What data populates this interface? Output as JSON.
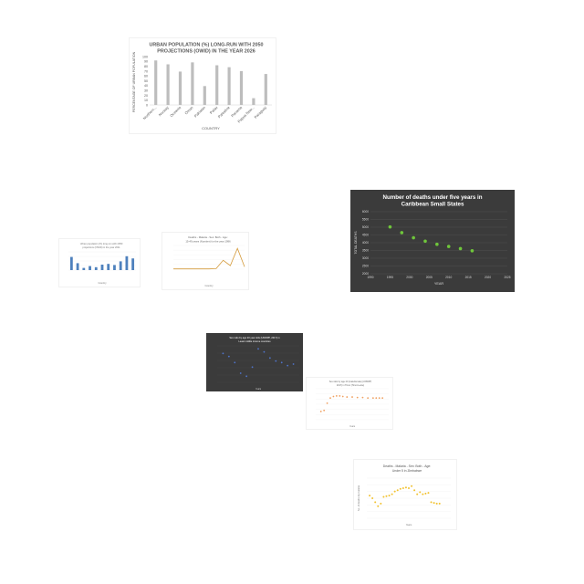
{
  "chart_data": [
    {
      "type": "bar",
      "title": "URBAN POPULATION (%) LONG-RUN WITH 2050 PROJECTIONS (OWID) IN THE YEAR 2026",
      "xlabel": "COUNTRY",
      "ylabel": "PERCENTAGE OF URBAN POPULATION",
      "ylim": [
        0,
        100
      ],
      "yticks": [
        0,
        10,
        20,
        30,
        40,
        50,
        60,
        70,
        80,
        90,
        100
      ],
      "categories": [
        "Northern...",
        "Norway",
        "Oceania",
        "Oman",
        "Pakistan",
        "Palau",
        "Palestine",
        "Panama",
        "Papua New...",
        "Paraguay"
      ],
      "values": [
        92,
        84,
        69,
        88,
        39,
        82,
        78,
        70,
        14,
        64
      ],
      "colors": {
        "bar": "#bdbdbd",
        "text": "#595959"
      }
    },
    {
      "type": "bar",
      "title": "Urban population (%) long-run with 2050 projections (OWID) in the year 2011",
      "xlabel": "Country",
      "ylabel": "",
      "ylim": [
        0,
        100
      ],
      "categories": [
        "",
        "",
        "",
        "",
        "",
        "",
        "",
        "",
        "",
        "",
        ""
      ],
      "values": [
        72,
        38,
        12,
        22,
        16,
        30,
        34,
        28,
        48,
        76,
        64
      ],
      "colors": {
        "bar": "#4e81bd"
      }
    },
    {
      "type": "line",
      "title": "Deaths - Malaria - Sex: Both - Age: 15-49 years (Number) for the year 1996",
      "xlabel": "Country",
      "ylabel": "",
      "categories": [
        "",
        "",
        "",
        "",
        "",
        "",
        "",
        "",
        "",
        "",
        ""
      ],
      "values": [
        1,
        1,
        1,
        1,
        1,
        1,
        2,
        30,
        12,
        70,
        8
      ],
      "colors": {
        "line": "#d49a3a"
      }
    },
    {
      "type": "scatter",
      "title": "Number of deaths under five years in Caribbean Small States",
      "xlabel": "YEAR",
      "ylabel": "TOTAL DEATHS",
      "xlim": [
        1990,
        2025
      ],
      "xticks": [
        1990,
        1995,
        2000,
        2005,
        2010,
        2015,
        2020,
        2025
      ],
      "ylim": [
        2000,
        6000
      ],
      "yticks": [
        2000,
        2500,
        3000,
        3500,
        4000,
        4500,
        5000,
        5500,
        6000
      ],
      "x": [
        1995,
        1998,
        2001,
        2004,
        2007,
        2010,
        2013,
        2016
      ],
      "y": [
        5020,
        4650,
        4320,
        4100,
        3900,
        3760,
        3620,
        3480
      ],
      "colors": {
        "point": "#6fc63b",
        "background": "#3b3b3b",
        "grid": "#555555",
        "text": "#d9d9d9"
      }
    },
    {
      "type": "scatter",
      "title": "Sex ratio by age 20 year olds (UNWPP, 2017) in Least middle income countries",
      "xlabel": "Years",
      "ylabel": "",
      "xlim": [
        1950,
        2020
      ],
      "ylim": [
        92,
        104
      ],
      "x": [
        1955,
        1960,
        1965,
        1970,
        1975,
        1980,
        1985,
        1990,
        1995,
        2000,
        2005,
        2010,
        2015
      ],
      "y": [
        101.5,
        100.5,
        98.5,
        95,
        94,
        97,
        103,
        102,
        100,
        99,
        98.5,
        97.5,
        98
      ],
      "colors": {
        "point": "#4f73c8",
        "background": "#3b3b3b",
        "text": "#d9d9d9"
      }
    },
    {
      "type": "scatter",
      "title": "Sex ratio by age 20 (male/female) (UNWPP, 2017) in Timor (Timor-Leste)",
      "xlabel": "Years",
      "ylabel": "",
      "xlim": [
        1950,
        2020
      ],
      "ylim": [
        80,
        110
      ],
      "x": [
        1955,
        1958,
        1961,
        1964,
        1967,
        1970,
        1973,
        1976,
        1980,
        1985,
        1990,
        1995,
        2000,
        2005,
        2008,
        2011,
        2014
      ],
      "y": [
        88,
        89,
        96,
        101,
        102.5,
        103,
        103,
        102.5,
        102,
        102,
        101.5,
        101.5,
        101,
        101,
        101,
        101,
        101
      ],
      "colors": {
        "point": "#f0a060"
      }
    },
    {
      "type": "scatter",
      "title": "Deaths - Malaria - Sex: Both - Age: Under 5 in Zimbabwe",
      "xlabel": "Years",
      "ylabel": "No. of deaths by malaria",
      "xlim": [
        1990,
        2020
      ],
      "ylim": [
        0,
        3000
      ],
      "x": [
        1991,
        1992,
        1993,
        1994,
        1995,
        1996,
        1997,
        1998,
        1999,
        2000,
        2001,
        2002,
        2003,
        2004,
        2005,
        2006,
        2007,
        2008,
        2009,
        2010,
        2011,
        2012,
        2013,
        2014,
        2015,
        2016
      ],
      "y": [
        1700,
        1500,
        1200,
        900,
        1100,
        1600,
        1650,
        1700,
        1800,
        2000,
        2100,
        2200,
        2250,
        2300,
        2250,
        2400,
        2100,
        1800,
        1950,
        1800,
        1850,
        1900,
        1200,
        1150,
        1100,
        1100
      ],
      "colors": {
        "point": "#f2c231"
      }
    }
  ]
}
